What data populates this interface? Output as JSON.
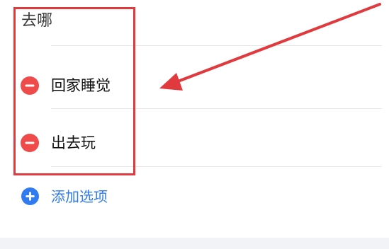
{
  "poll": {
    "title": "去哪",
    "options": [
      {
        "label": "回家睡觉"
      },
      {
        "label": "出去玩"
      }
    ],
    "add_option_label": "添加选项"
  },
  "colors": {
    "remove_icon": "#ef4b4b",
    "add_icon": "#2f7bef",
    "annotation": "#e03a3e",
    "divider": "#e6e6ea",
    "footer_band": "#f2f3f7"
  },
  "icons": {
    "remove": "minus-circle-icon",
    "add": "plus-circle-icon",
    "annotation_arrow": "arrow-icon"
  }
}
